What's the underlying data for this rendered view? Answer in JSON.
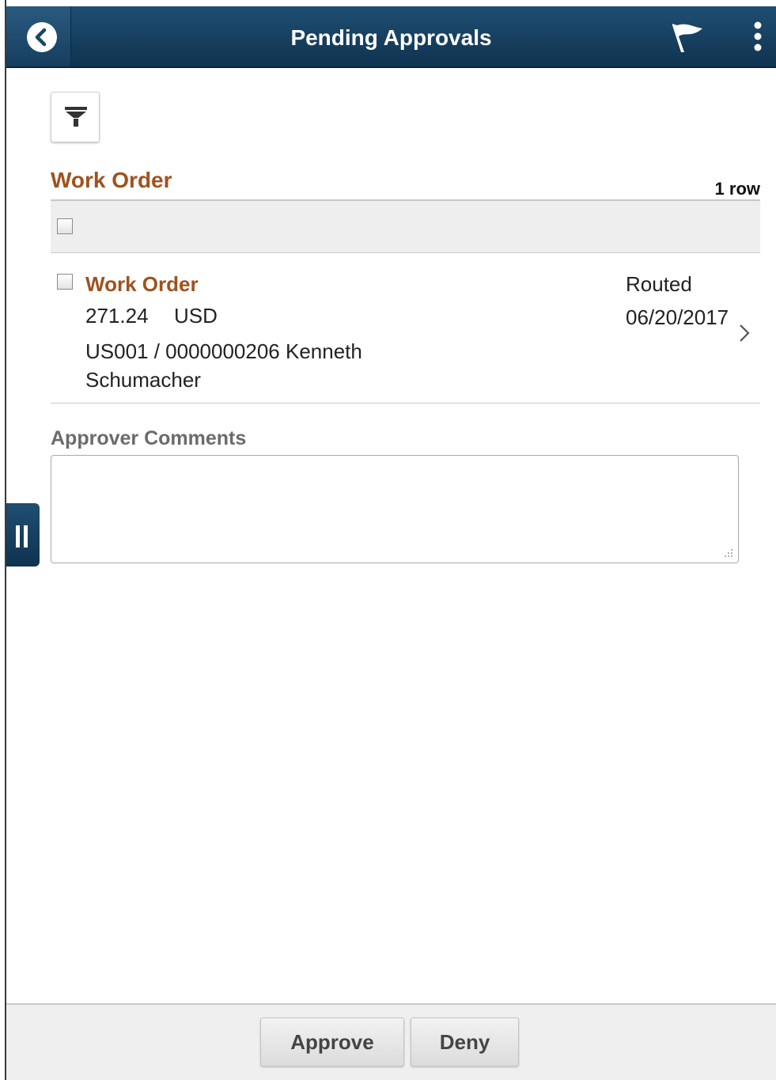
{
  "header": {
    "title": "Pending Approvals",
    "icons": [
      "chevron-left-icon",
      "flag-icon",
      "more-vertical-icon"
    ],
    "color": "#1a4766"
  },
  "filter": {
    "icon": "filter-icon"
  },
  "section": {
    "title": "Work Order",
    "row_count": "1 row"
  },
  "items": [
    {
      "title": "Work Order",
      "amount": "271.24",
      "currency": "USD",
      "description": "US001 / 0000000206  Kenneth Schumacher",
      "status": "Routed",
      "date": "06/20/2017"
    }
  ],
  "comments": {
    "label": "Approver Comments",
    "value": ""
  },
  "footer": {
    "approve_label": "Approve",
    "deny_label": "Deny"
  },
  "colors": {
    "accent": "#a0521d",
    "header_bg": "#1a4766"
  }
}
